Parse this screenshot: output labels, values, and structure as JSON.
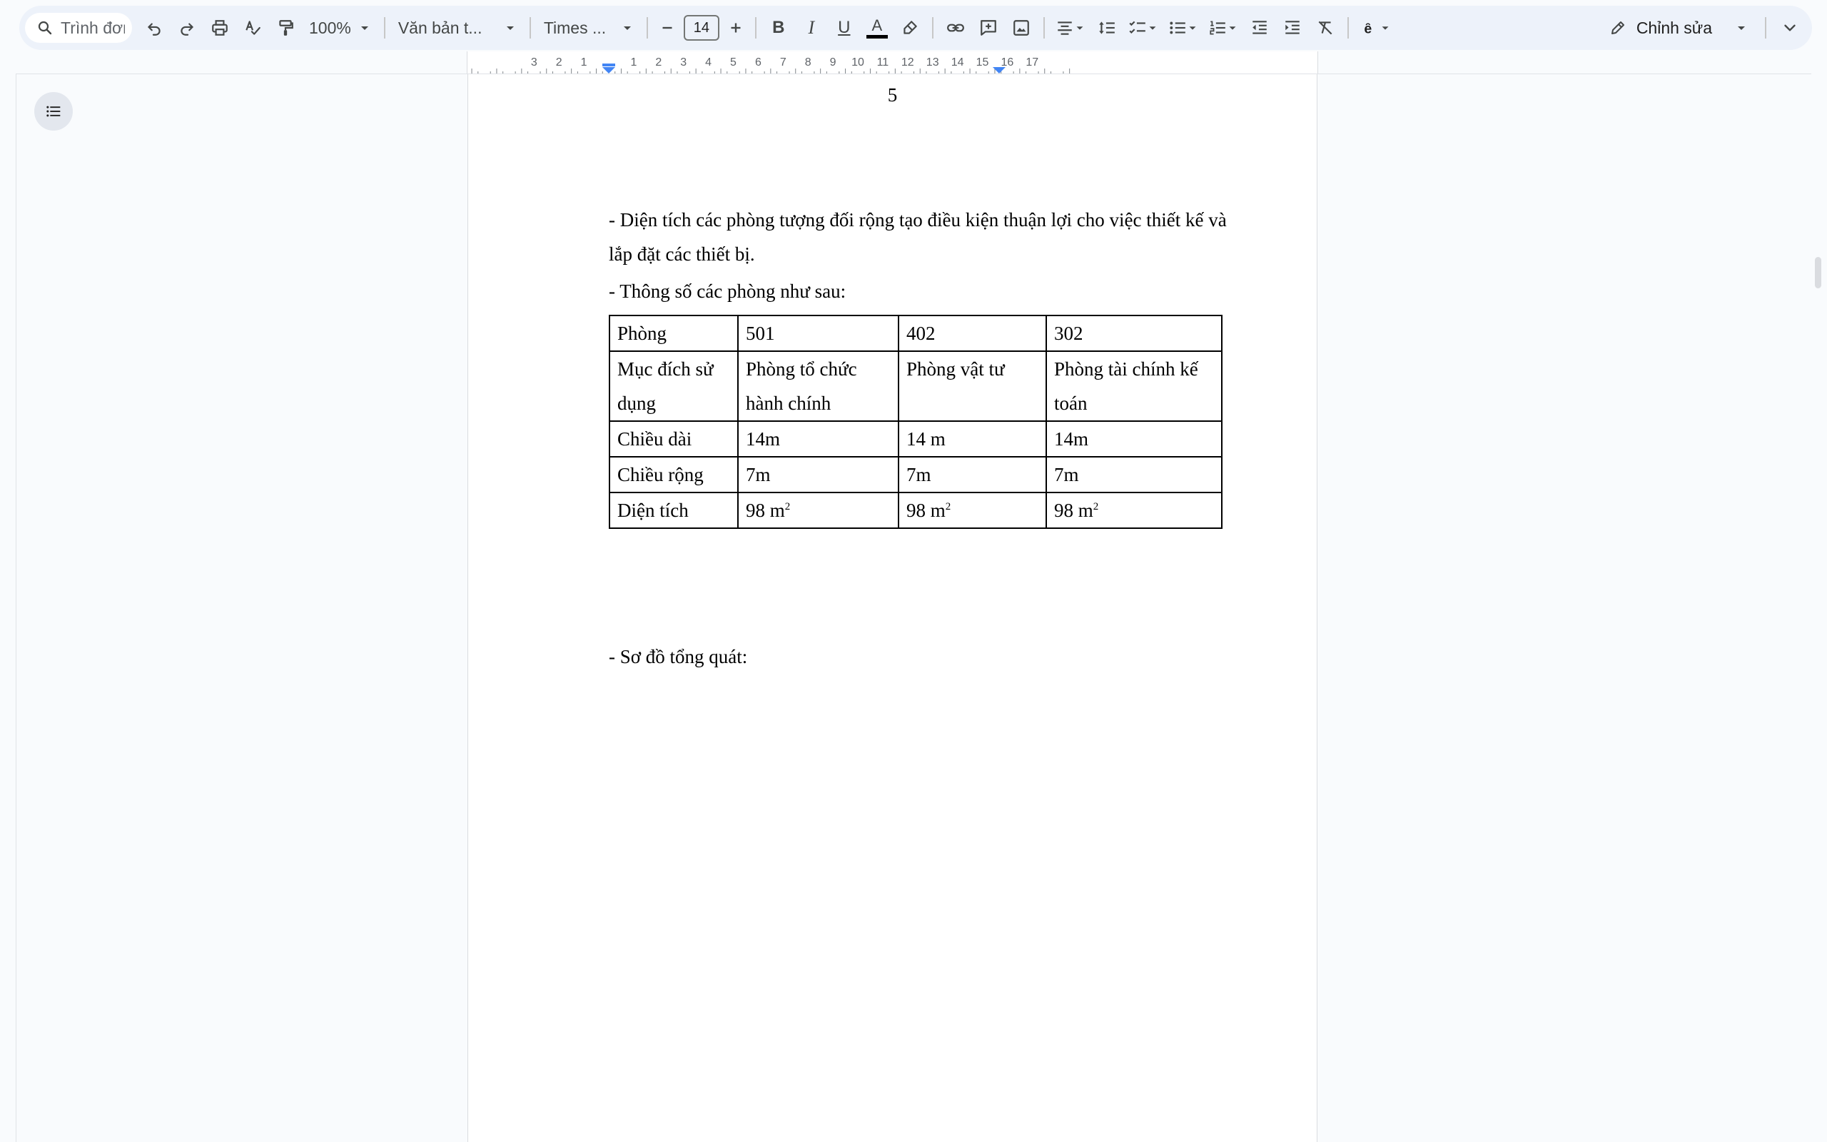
{
  "toolbar": {
    "search_placeholder": "Trình đơn",
    "zoom": "100%",
    "style": "Văn bản t...",
    "font": "Times ...",
    "font_size": "14",
    "bold_label": "B",
    "italic_label": "I",
    "underline_label": "U",
    "text_color_label": "A",
    "text_color_bar": "#000000",
    "mode_label": "Chỉnh sửa"
  },
  "ruler": {
    "left_labels": [
      "3",
      "2",
      "1"
    ],
    "right_labels": [
      "1",
      "2",
      "3",
      "4",
      "5",
      "6",
      "7",
      "8",
      "9",
      "10",
      "11",
      "12",
      "13",
      "14",
      "15",
      "16",
      "17"
    ],
    "marker_color": "#4285f4"
  },
  "document": {
    "page_number": "5",
    "para1": "- Diện tích các phòng tượng đối rộng tạo điều kiện thuận lợi cho việc thiết kế và lắp đặt các thiết bị.",
    "para2": "- Thông số các phòng như sau:",
    "para3": "- Sơ đồ tổng quát:",
    "table": {
      "rows": [
        [
          "Phòng",
          "501",
          "402",
          "302"
        ],
        [
          "Mục đích sử dụng",
          "Phòng tổ chức hành chính",
          "Phòng vật tư",
          "Phòng tài chính kế toán"
        ],
        [
          "Chiều dài",
          "14m",
          "14 m",
          "14m"
        ],
        [
          "Chiều rộng",
          "7m",
          "7m",
          "7m"
        ],
        [
          "Diện tích",
          "98 m",
          "98 m",
          "98 m"
        ]
      ],
      "area_superscript": "2"
    }
  },
  "colors": {
    "toolbar_bg": "#edf2fa",
    "canvas_bg": "#f9fbfd",
    "page_bg": "#ffffff",
    "accent": "#4285f4"
  }
}
